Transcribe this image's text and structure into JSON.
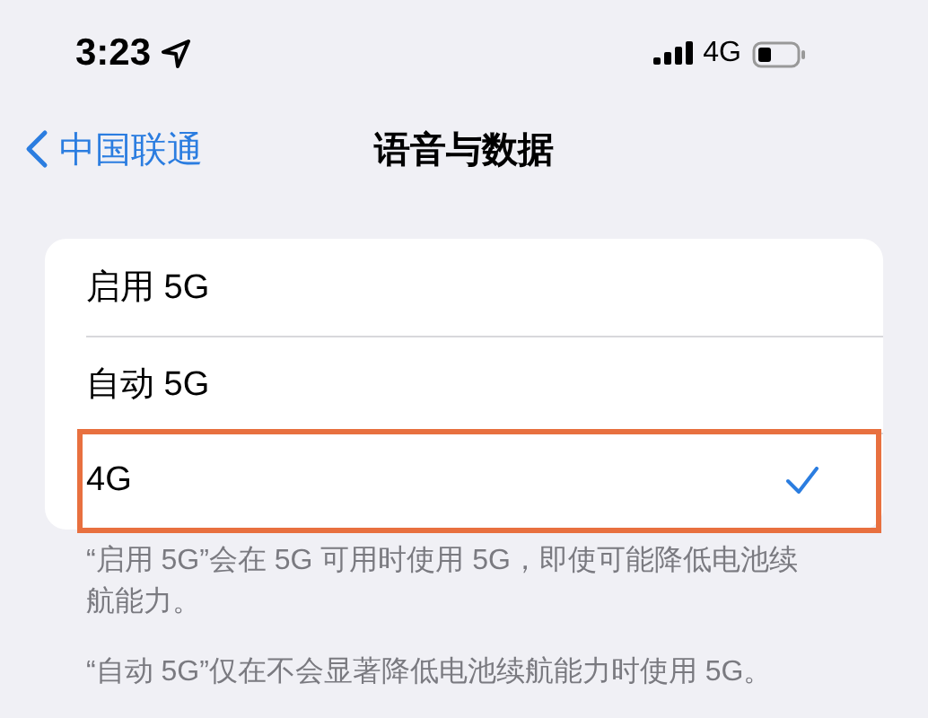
{
  "status_bar": {
    "time": "3:23",
    "network": "4G"
  },
  "nav": {
    "back": "中国联通",
    "title": "语音与数据"
  },
  "options": [
    {
      "label": "启用 5G",
      "selected": false,
      "highlighted": false
    },
    {
      "label": "自动 5G",
      "selected": false,
      "highlighted": false
    },
    {
      "label": "4G",
      "selected": true,
      "highlighted": true
    }
  ],
  "footer": [
    "“启用 5G”会在 5G 可用时使用 5G，即使可能降低电池续航能力。",
    "“自动 5G”仅在不会显著降低电池续航能力时使用 5G。"
  ]
}
